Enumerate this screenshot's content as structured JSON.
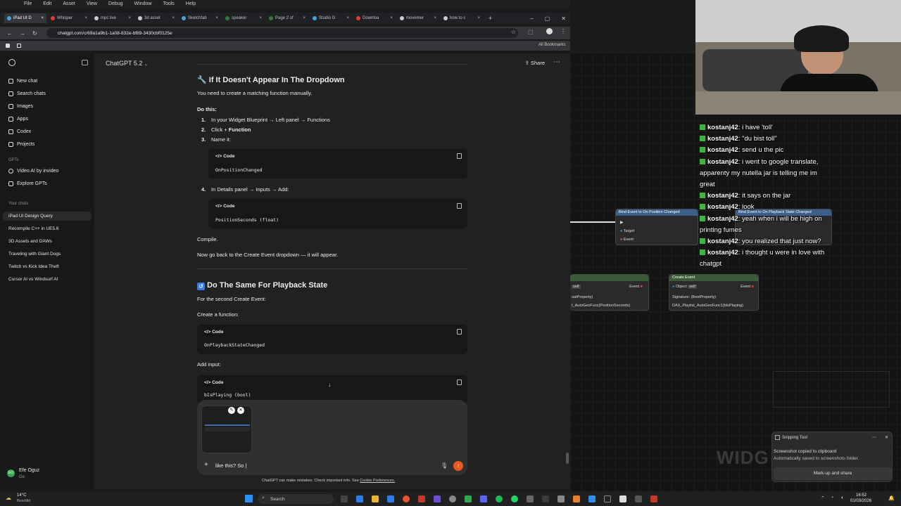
{
  "app_menu": [
    "File",
    "Edit",
    "Asset",
    "View",
    "Debug",
    "Window",
    "Tools",
    "Help"
  ],
  "browser": {
    "tabs": [
      {
        "label": "iPad UI D",
        "color": "#4aa3df",
        "active": true
      },
      {
        "label": "Whisper",
        "color": "#e53935"
      },
      {
        "label": "mpc live",
        "color": "#ccc"
      },
      {
        "label": "3d asset",
        "color": "#ccc"
      },
      {
        "label": "Sketchfab",
        "color": "#4aa3df"
      },
      {
        "label": "speaker",
        "color": "#2e7d32"
      },
      {
        "label": "Page 2 of",
        "color": "#2e7d32"
      },
      {
        "label": "Studio G",
        "color": "#4aa3df"
      },
      {
        "label": "Downloa",
        "color": "#e53935"
      },
      {
        "label": "movemer",
        "color": "#ccc"
      },
      {
        "label": "how to c",
        "color": "#ccc"
      }
    ],
    "url": "chatgpt.com/c/69a1a9b1-1a08-832e-bf89-3430cbf0125e",
    "all_bookmarks": "All Bookmarks"
  },
  "sidebar": {
    "items": [
      "New chat",
      "Search chats",
      "Images",
      "Apps",
      "Codex",
      "Projects"
    ],
    "gpts_label": "GPTs",
    "gpts": [
      "Video AI by invideo",
      "Explore GPTs"
    ],
    "chats_label": "Your chats",
    "chats": [
      "iPad UI Design Query",
      "Recompile C++ in UE5.6",
      "3D Assets and DAWs",
      "Traveling with Giant Dogs",
      "Twitch vs Kick Idea Theft",
      "Cursor AI vs Windsurf AI"
    ],
    "user_name": "Efe Oguz",
    "user_plan": "Go",
    "user_initials": "EO"
  },
  "header": {
    "title": "ChatGPT 5.2",
    "share": "Share"
  },
  "content": {
    "h1": "If It Doesn't Appear In The Dropdown",
    "p1": "You need to create a matching function manually.",
    "do_this": "Do this:",
    "step1": "In your Widget Blueprint → Left panel → Functions",
    "step2_pre": "Click + ",
    "step2_bold": "Function",
    "step3": "Name it:",
    "code_label": "Code",
    "code1": "OnPositionChanged",
    "step4": "In Details panel → Inputs → Add:",
    "code2": "PositionSeconds (float)",
    "compile": "Compile.",
    "now_go": "Now go back to the Create Event dropdown — it will appear.",
    "h2": "Do The Same For Playback State",
    "p2": "For the second Create Event:",
    "create_fn": "Create a function:",
    "code3": "OnPlaybackStateChanged",
    "add_input": "Add input:",
    "code4": "bIsPlaying (bool)"
  },
  "composer": {
    "text": "like this? So |"
  },
  "disclaimer": {
    "text": "ChatGPT can make mistakes. Check important info. See ",
    "link": "Cookie Preferences."
  },
  "unreal": {
    "node_bind_1": "Bind Event to On Position Changed",
    "node_bind_2": "Bind Event to On Playback State Changed",
    "target": "Target",
    "event": "Event",
    "create_event": "Create Event",
    "object": "Object",
    "self": "self",
    "signature": "Signature: (BoolProperty)",
    "func": "DAX_Playlist_AutoGenFunc1(bIsPlaying)",
    "left_sig": "oatProperty)",
    "left_func": "t_AutoGenFunc(PositionSeconds)",
    "widget_text": "WIDG"
  },
  "twitch_chat": [
    {
      "user": "kostanj42",
      "msg": "i have 'toll'"
    },
    {
      "user": "kostanj42",
      "msg": "\"du bist toll\""
    },
    {
      "user": "kostanj42",
      "msg": "send u the pic"
    },
    {
      "user": "kostanj42",
      "msg": "i went to google translate, apparenty my nutella jar is telling me im great"
    },
    {
      "user": "kostanj42",
      "msg": "it says on the jar"
    },
    {
      "user": "kostanj42",
      "msg": "look"
    },
    {
      "user": "kostanj42",
      "msg": "yeah when i will be high on printing fumes"
    },
    {
      "user": "kostanj42",
      "msg": "you realized that just now?"
    },
    {
      "user": "kostanj42",
      "msg": "i thought u were in love with chatgpt"
    }
  ],
  "snipping": {
    "title": "Snipping Tool",
    "line1": "Screenshot copied to clipboard",
    "line2": "Automatically saved to screenshots folder.",
    "button": "Mark-up and share"
  },
  "taskbar": {
    "weather_temp": "14°C",
    "weather_desc": "Bewölkt",
    "search": "Search",
    "time": "16:52",
    "date": "01/03/2026"
  }
}
